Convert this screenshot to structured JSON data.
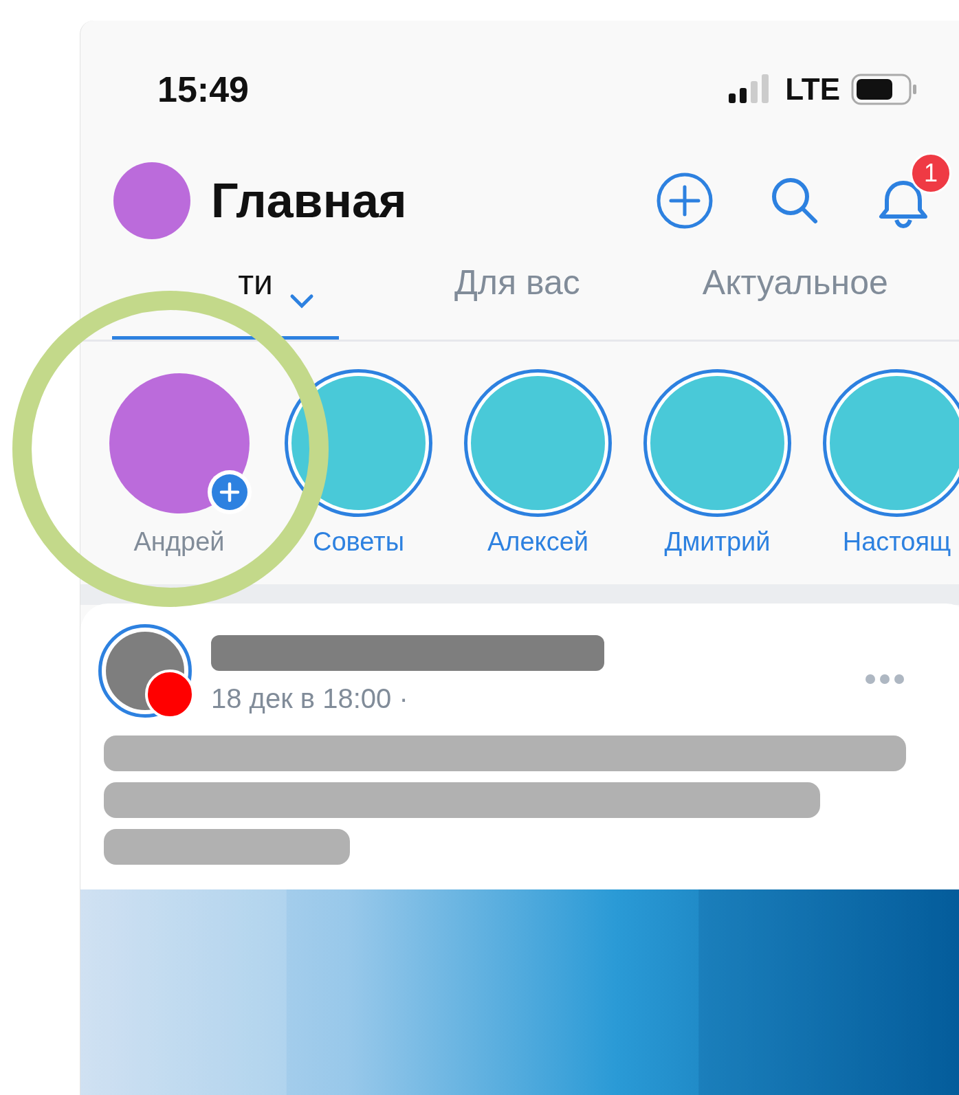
{
  "status_bar": {
    "time": "15:49",
    "network": "LTE"
  },
  "header": {
    "title": "Главная",
    "notification_count": "1"
  },
  "tabs": [
    {
      "label": "ти",
      "selected": true,
      "dropdown": true
    },
    {
      "label": "Для вас",
      "selected": false,
      "dropdown": false
    },
    {
      "label": "Актуальное",
      "selected": false,
      "dropdown": false
    }
  ],
  "stories": [
    {
      "name": "Андрей",
      "kind": "own"
    },
    {
      "name": "Советы",
      "kind": "story"
    },
    {
      "name": "Алексей",
      "kind": "story"
    },
    {
      "name": "Дмитрий",
      "kind": "story"
    },
    {
      "name": "Настоящ",
      "kind": "story"
    }
  ],
  "post": {
    "date": "18 дек в 18:00 ·",
    "live": true
  }
}
